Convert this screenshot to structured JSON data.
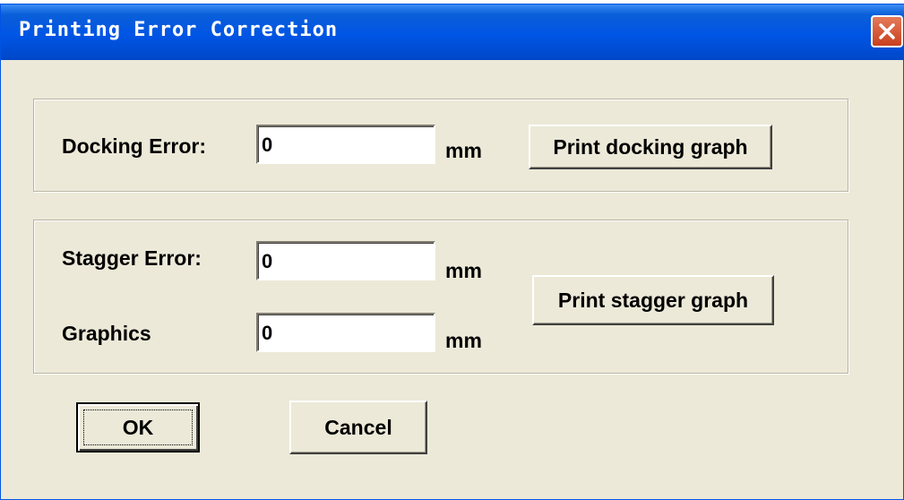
{
  "window": {
    "title": "Printing Error Correction"
  },
  "docking": {
    "label": "Docking Error:",
    "value": "0",
    "unit": "mm",
    "button_label": "Print docking graph"
  },
  "stagger": {
    "label": "Stagger Error:",
    "value": "0",
    "unit": "mm",
    "button_label": "Print stagger graph"
  },
  "graphics": {
    "label": "Graphics",
    "value": "0",
    "unit": "mm"
  },
  "actions": {
    "ok_label": "OK",
    "cancel_label": "Cancel"
  },
  "colors": {
    "title_bar": "#0055E5",
    "dialog_bg": "#ECE9D8",
    "close_button": "#C8401E"
  },
  "icons": {
    "close": "close-icon"
  }
}
